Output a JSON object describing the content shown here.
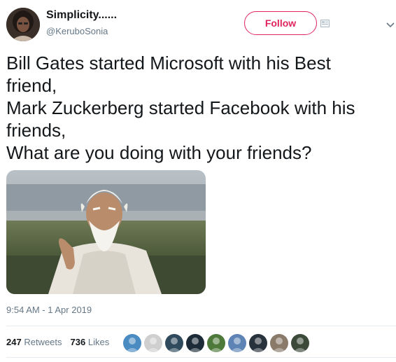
{
  "author": {
    "display_name": "Simplicity......",
    "handle": "@KeruboSonia",
    "avatar_icon": "user-avatar"
  },
  "follow_button": {
    "label": "Follow",
    "color": "#e0245e"
  },
  "tweet": {
    "lines": [
      "Bill Gates started Microsoft with his Best",
      "friend,",
      "Mark Zuckerberg started Facebook with his",
      "friends,",
      "What are you doing with your friends?"
    ],
    "media": {
      "icon": "photo-old-master-meme"
    },
    "timestamp": "9:54 AM - 1 Apr 2019"
  },
  "stats": {
    "retweets_count": "247",
    "retweets_label": "Retweets",
    "likes_count": "736",
    "likes_label": "Likes"
  },
  "likers": [
    {
      "icon": "liker-avatar",
      "color": "#4a8bc2"
    },
    {
      "icon": "liker-avatar",
      "color": "#cfcfcf"
    },
    {
      "icon": "liker-avatar",
      "color": "#2f4a5c"
    },
    {
      "icon": "liker-avatar",
      "color": "#1d2b38"
    },
    {
      "icon": "liker-avatar",
      "color": "#4d7a3a"
    },
    {
      "icon": "liker-avatar",
      "color": "#5d84b5"
    },
    {
      "icon": "liker-avatar",
      "color": "#27323c"
    },
    {
      "icon": "liker-avatar",
      "color": "#8a7a6a"
    },
    {
      "icon": "liker-avatar",
      "color": "#3c4a3a"
    }
  ],
  "colors": {
    "text": "#14171a",
    "secondary": "#657786",
    "divider": "#e6ecf0"
  }
}
